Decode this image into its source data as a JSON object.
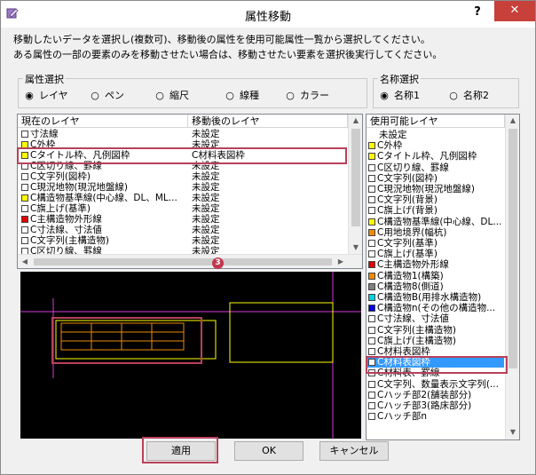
{
  "window": {
    "title": "属性移動",
    "help_label": "?",
    "close_label": "✕"
  },
  "description": {
    "line1": "移動したいデータを選択し(複数可)、移動後の属性を使用可能属性一覧から選択してください。",
    "line2": "ある属性の一部の要素のみを移動させたい場合は、移動させたい要素を選択後実行してください。"
  },
  "attribute_group": {
    "label": "属性選択",
    "options": [
      "レイヤ",
      "ペン",
      "縮尺",
      "線種",
      "カラー"
    ],
    "selected": "レイヤ"
  },
  "name_group": {
    "label": "名称選択",
    "options": [
      "名称1",
      "名称2"
    ],
    "selected": "名称1"
  },
  "layer_list": {
    "columns": [
      "現在のレイヤ",
      "移動後のレイヤ"
    ],
    "rows": [
      {
        "name": "寸法線",
        "target": "未設定",
        "color": "#ffffff",
        "selected": false
      },
      {
        "name": "C外枠",
        "target": "未設定",
        "color": "#ffff00",
        "selected": false
      },
      {
        "name": "Cタイトル枠、凡例図枠",
        "target": "C材料表図枠",
        "color": "#ffff00",
        "selected": true
      },
      {
        "name": "C区切り線、罫線",
        "target": "未設定",
        "color": "#ffffff",
        "selected": false
      },
      {
        "name": "C文字列(図枠)",
        "target": "未設定",
        "color": "#ffffff",
        "selected": false
      },
      {
        "name": "C現況地物(現況地盤線)",
        "target": "未設定",
        "color": "#ffffff",
        "selected": false
      },
      {
        "name": "C構造物基準線(中心線、DL、ML...",
        "target": "未設定",
        "color": "#ffff00",
        "selected": false
      },
      {
        "name": "C旗上げ(基準)",
        "target": "未設定",
        "color": "#ffffff",
        "selected": false
      },
      {
        "name": "C主構造物外形線",
        "target": "未設定",
        "color": "#e00000",
        "selected": false
      },
      {
        "name": "C寸法線、寸法値",
        "target": "未設定",
        "color": "#ffffff",
        "selected": false
      },
      {
        "name": "C文字列(主構造物)",
        "target": "未設定",
        "color": "#ffffff",
        "selected": false
      },
      {
        "name": "C区切り線、罫線",
        "target": "未設定",
        "color": "#ffffff",
        "selected": false
      }
    ]
  },
  "available_list": {
    "header": "使用可能レイヤ",
    "items": [
      {
        "name": "未設定",
        "color": "",
        "selected": false
      },
      {
        "name": "C外枠",
        "color": "#ffff00",
        "selected": false
      },
      {
        "name": "Cタイトル枠、凡例図枠",
        "color": "#ffff00",
        "selected": false
      },
      {
        "name": "C区切り線、罫線",
        "color": "#ffffff",
        "selected": false
      },
      {
        "name": "C文字列(図枠)",
        "color": "#ffffff",
        "selected": false
      },
      {
        "name": "C現況地物(現況地盤線)",
        "color": "#ffffff",
        "selected": false
      },
      {
        "name": "C文字列(背景)",
        "color": "#ffffff",
        "selected": false
      },
      {
        "name": "C旗上げ(背景)",
        "color": "#ffffff",
        "selected": false
      },
      {
        "name": "C構造物基準線(中心線、DL...",
        "color": "#ffff00",
        "selected": false
      },
      {
        "name": "C用地境界(幅杭)",
        "color": "#f08a00",
        "selected": false
      },
      {
        "name": "C文字列(基準)",
        "color": "#ffffff",
        "selected": false
      },
      {
        "name": "C旗上げ(基準)",
        "color": "#ffffff",
        "selected": false
      },
      {
        "name": "C主構造物外形線",
        "color": "#e00000",
        "selected": false
      },
      {
        "name": "C構造物1(構築)",
        "color": "#f08a00",
        "selected": false
      },
      {
        "name": "C構造物8(側道)",
        "color": "#808080",
        "selected": false
      },
      {
        "name": "C構造物B(用排水構造物)",
        "color": "#00d0e0",
        "selected": false
      },
      {
        "name": "C構造物n(その他の構造物...",
        "color": "#0000e0",
        "selected": false
      },
      {
        "name": "C寸法線、寸法値",
        "color": "#ffffff",
        "selected": false
      },
      {
        "name": "C文字列(主構造物)",
        "color": "#ffffff",
        "selected": false
      },
      {
        "name": "C旗上げ(主構造物)",
        "color": "#ffffff",
        "selected": false
      },
      {
        "name": "C材料表図枠",
        "color": "#ffffff",
        "selected": false
      },
      {
        "name": "C材料表図枠",
        "color": "#ffffff",
        "selected": true
      },
      {
        "name": "C材料表、罫線",
        "color": "#ffffff",
        "selected": false
      },
      {
        "name": "C文字列、数量表示文字列(...",
        "color": "#ffffff",
        "selected": false
      },
      {
        "name": "Cハッチ部2(舗装部分)",
        "color": "#ffffff",
        "selected": false
      },
      {
        "name": "Cハッチ部3(路床部分)",
        "color": "#ffffff",
        "selected": false
      },
      {
        "name": "Cハッチ部n",
        "color": "#ffffff",
        "selected": false
      }
    ]
  },
  "step_badge": "3",
  "buttons": {
    "apply": "適用",
    "ok": "OK",
    "cancel": "キャンセル"
  }
}
